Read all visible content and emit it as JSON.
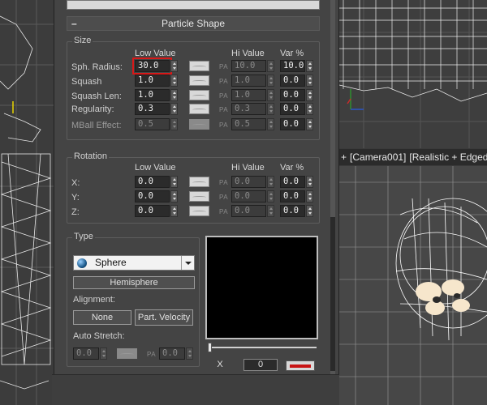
{
  "rollout": {
    "title": "Particle Shape",
    "collapse_glyph": "–"
  },
  "size": {
    "group_label": "Size",
    "col_low": "Low Value",
    "col_hi": "Hi Value",
    "col_var": "Var %",
    "rows": [
      {
        "label": "Sph. Radius:",
        "low": "30.0",
        "hi": "10.0",
        "var": "10.0"
      },
      {
        "label": "Squash",
        "low": "1.0",
        "hi": "1.0",
        "var": "0.0"
      },
      {
        "label": "Squash Len:",
        "low": "1.0",
        "hi": "1.0",
        "var": "0.0"
      },
      {
        "label": "Regularity:",
        "low": "0.3",
        "hi": "0.3",
        "var": "0.0"
      },
      {
        "label": "MBall Effect:",
        "low": "0.5",
        "hi": "0.5",
        "var": "0.0"
      }
    ]
  },
  "rotation": {
    "group_label": "Rotation",
    "col_low": "Low Value",
    "col_hi": "Hi Value",
    "col_var": "Var %",
    "rows": [
      {
        "label": "X:",
        "low": "0.0",
        "hi": "0.0",
        "var": "0.0"
      },
      {
        "label": "Y:",
        "low": "0.0",
        "hi": "0.0",
        "var": "0.0"
      },
      {
        "label": "Z:",
        "low": "0.0",
        "hi": "0.0",
        "var": "0.0"
      }
    ]
  },
  "type_group": {
    "group_label": "Type",
    "shape_selected": "Sphere",
    "hemisphere_button": "Hemisphere",
    "alignment_label": "Alignment:",
    "none_button": "None",
    "part_velocity_button": "Part. Velocity",
    "auto_stretch_label": "Auto Stretch:",
    "auto_stretch_low": "0.0",
    "auto_stretch_hi": "0.0"
  },
  "pa_text": "PA",
  "preview": {
    "x_button": "X",
    "frame_value": "0",
    "swatch_color": "#c81414"
  },
  "viewport": {
    "label_prefix": "+",
    "camera_label": "[Camera001]",
    "shading_label": "[Realistic + Edged F"
  },
  "colors": {
    "highlight": "#d81818",
    "panel_bg": "#444444"
  }
}
